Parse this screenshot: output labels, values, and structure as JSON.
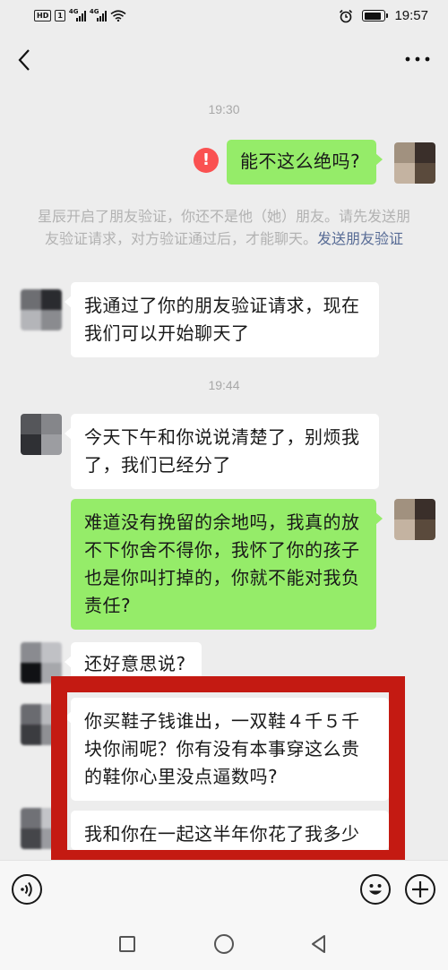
{
  "status_bar": {
    "hd_label": "HD",
    "sim_label": "1",
    "signal_labels": [
      "4G",
      "4G"
    ],
    "time": "19:57",
    "battery_fraction": 0.85
  },
  "nav": {
    "back_icon": "chevron-left-icon",
    "more_icon": "more-dots-icon"
  },
  "chat": {
    "timestamp_1": "19:30",
    "outgoing_1": "能不这么绝吗?",
    "error_icon_glyph": "!",
    "system_message_text": "星辰开启了朋友验证，你还不是他（她）朋友。请先发送朋友验证请求，对方验证通过后，才能聊天。",
    "system_message_link": "发送朋友验证",
    "incoming_1_line_1": "我通过了你的朋友验证请求，现在",
    "incoming_1_line_2": "我们可以开始聊天了",
    "timestamp_2": "19:44",
    "incoming_2_line_1": "今天下午和你说说清楚了，别烦我",
    "incoming_2_line_2": "了，我们已经分了",
    "outgoing_2_line_1": "难道没有挽留的余地吗，我真的放",
    "outgoing_2_line_2": "不下你舍不得你，我怀了你的孩子",
    "outgoing_2_line_3": "也是你叫打掉的，你就不能对我负",
    "outgoing_2_line_4": "责任?",
    "incoming_3": "还好意思说?",
    "incoming_4_line_1": "你买鞋子钱谁出，一双鞋４千５千",
    "incoming_4_line_2": "块你闹呢？你有没有本事穿这么贵",
    "incoming_4_line_3": "的鞋你心里没点逼数吗?",
    "incoming_5_partial": "我和你在一起这半年你花了我多少"
  },
  "colors": {
    "outgoing_bubble": "#95ec69",
    "incoming_bubble": "#ffffff",
    "error_red": "#fa5151",
    "highlight_box": "#c41a12",
    "link_blue": "#576b95",
    "background": "#ededed"
  },
  "input_bar": {
    "voice_icon": "voice-icon",
    "emoji_icon": "emoji-icon",
    "plus_icon": "plus-icon"
  },
  "system_nav": {
    "recent_icon": "square-icon",
    "home_icon": "circle-icon",
    "back_icon": "triangle-back-icon"
  }
}
